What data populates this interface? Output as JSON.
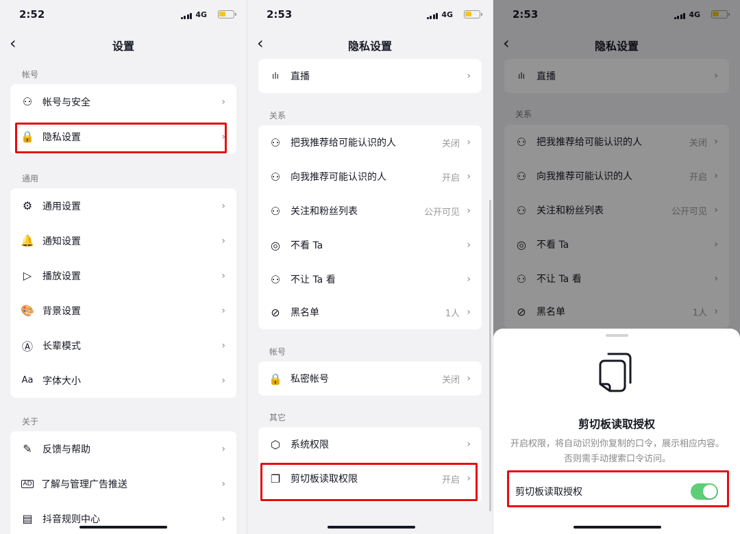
{
  "screens": [
    {
      "time": "2:52",
      "network": "4G",
      "title": "设置",
      "sections": [
        {
          "label": "帐号",
          "items": [
            {
              "icon": "user-icon",
              "glyph": "⚇",
              "label": "帐号与安全",
              "value": ""
            },
            {
              "icon": "lock-icon",
              "glyph": "🔒",
              "label": "隐私设置",
              "value": ""
            }
          ]
        },
        {
          "label": "通用",
          "items": [
            {
              "icon": "gear-icon",
              "glyph": "⚙",
              "label": "通用设置",
              "value": ""
            },
            {
              "icon": "bell-icon",
              "glyph": "🔔",
              "label": "通知设置",
              "value": ""
            },
            {
              "icon": "play-icon",
              "glyph": "▷",
              "label": "播放设置",
              "value": ""
            },
            {
              "icon": "palette-icon",
              "glyph": "🎨",
              "label": "背景设置",
              "value": ""
            },
            {
              "icon": "elder-mode-icon",
              "glyph": "Ⓐ",
              "label": "长辈模式",
              "value": ""
            },
            {
              "icon": "font-size-icon",
              "glyph": "Aa",
              "label": "字体大小",
              "value": ""
            }
          ]
        },
        {
          "label": "关于",
          "items": [
            {
              "icon": "pen-icon",
              "glyph": "✎",
              "label": "反馈与帮助",
              "value": ""
            },
            {
              "icon": "ad-icon",
              "glyph": "AD",
              "label": "了解与管理广告推送",
              "value": ""
            },
            {
              "icon": "document-icon",
              "glyph": "▤",
              "label": "抖音规则中心",
              "value": ""
            }
          ]
        }
      ]
    },
    {
      "time": "2:53",
      "network": "4G",
      "title": "隐私设置",
      "top_item": {
        "icon": "live-icon",
        "glyph": "ılı",
        "label": "直播",
        "value": ""
      },
      "sections": [
        {
          "label": "关系",
          "items": [
            {
              "icon": "recommend-me-icon",
              "glyph": "⚇",
              "label": "把我推荐给可能认识的人",
              "value": "关闭"
            },
            {
              "icon": "recommend-others-icon",
              "glyph": "⚇",
              "label": "向我推荐可能认识的人",
              "value": "开启"
            },
            {
              "icon": "users-icon",
              "glyph": "⚇",
              "label": "关注和粉丝列表",
              "value": "公开可见"
            },
            {
              "icon": "eye-off-icon",
              "glyph": "◎",
              "label": "不看 Ta",
              "value": ""
            },
            {
              "icon": "user-lock-icon",
              "glyph": "⚇",
              "label": "不让 Ta 看",
              "value": ""
            },
            {
              "icon": "block-icon",
              "glyph": "⊘",
              "label": "黑名单",
              "value": "1人"
            }
          ]
        },
        {
          "label": "帐号",
          "items": [
            {
              "icon": "lock-icon",
              "glyph": "🔒",
              "label": "私密帐号",
              "value": "关闭"
            }
          ]
        },
        {
          "label": "其它",
          "items": [
            {
              "icon": "hexagon-settings-icon",
              "glyph": "⬡",
              "label": "系统权限",
              "value": ""
            },
            {
              "icon": "clipboard-icon",
              "glyph": "❐",
              "label": "剪切板读取权限",
              "value": "开启"
            }
          ]
        }
      ]
    },
    {
      "time": "2:53",
      "network": "4G",
      "title": "隐私设置",
      "sheet": {
        "title": "剪切板读取授权",
        "description": "开启权限，将自动识别你复制的口令，展示相应内容。否则需手动搜索口令访问。",
        "toggle_label": "剪切板读取授权",
        "toggle_on": true
      }
    }
  ],
  "colors": {
    "highlight": "#e50b0b",
    "toggle_on": "#5fcf77",
    "background": "#f2f2f4"
  }
}
